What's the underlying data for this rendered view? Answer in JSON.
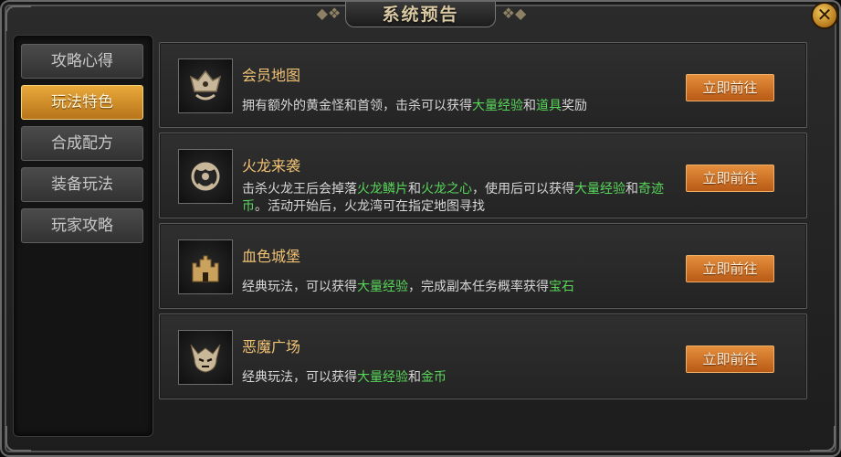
{
  "window": {
    "title": "系统预告",
    "close_icon": "close-icon"
  },
  "sidebar": {
    "tabs": [
      {
        "label": "攻略心得",
        "active": false
      },
      {
        "label": "玩法特色",
        "active": true
      },
      {
        "label": "合成配方",
        "active": false
      },
      {
        "label": "装备玩法",
        "active": false
      },
      {
        "label": "玩家攻略",
        "active": false
      }
    ]
  },
  "cards": [
    {
      "title": "会员地图",
      "icon": "crown-emblem-icon",
      "desc_parts": [
        {
          "text": "拥有额外的黄金怪和首领，击杀可以获得",
          "highlight": false
        },
        {
          "text": "大量经验",
          "highlight": true
        },
        {
          "text": "和",
          "highlight": false
        },
        {
          "text": "道具",
          "highlight": true
        },
        {
          "text": "奖励",
          "highlight": false
        }
      ],
      "button": "立即前往"
    },
    {
      "title": "火龙来袭",
      "icon": "dragon-emblem-icon",
      "desc_parts": [
        {
          "text": "击杀火龙王后会掉落",
          "highlight": false
        },
        {
          "text": "火龙鳞片",
          "highlight": true
        },
        {
          "text": "和",
          "highlight": false
        },
        {
          "text": "火龙之心",
          "highlight": true
        },
        {
          "text": "，使用后可以获得",
          "highlight": false
        },
        {
          "text": "大量经验",
          "highlight": true
        },
        {
          "text": "和",
          "highlight": false
        },
        {
          "text": "奇迹币",
          "highlight": true
        },
        {
          "text": "。活动开始后，火龙湾可在指定地图寻找",
          "highlight": false
        }
      ],
      "button": "立即前往"
    },
    {
      "title": "血色城堡",
      "icon": "castle-icon",
      "desc_parts": [
        {
          "text": "经典玩法，可以获得",
          "highlight": false
        },
        {
          "text": "大量经验",
          "highlight": true
        },
        {
          "text": "，完成副本任务概率获得",
          "highlight": false
        },
        {
          "text": "宝石",
          "highlight": true
        }
      ],
      "button": "立即前往"
    },
    {
      "title": "恶魔广场",
      "icon": "demon-helmet-icon",
      "desc_parts": [
        {
          "text": "经典玩法，可以获得",
          "highlight": false
        },
        {
          "text": "大量经验",
          "highlight": true
        },
        {
          "text": "和",
          "highlight": false
        },
        {
          "text": "金币",
          "highlight": true
        }
      ],
      "button": "立即前往"
    }
  ],
  "colors": {
    "accent": "#f0c274",
    "highlight": "#58d65a",
    "button": "#d27a2a"
  }
}
